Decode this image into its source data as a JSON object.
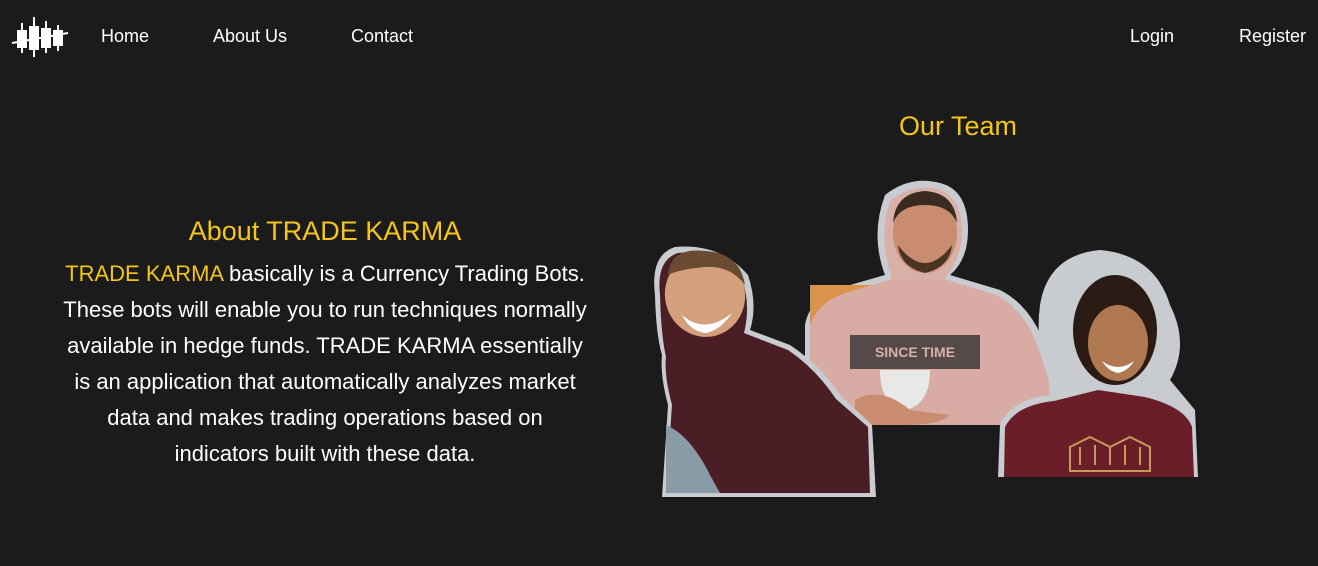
{
  "nav": {
    "links": [
      "Home",
      "About Us",
      "Contact"
    ],
    "login": "Login",
    "register": "Register"
  },
  "about": {
    "title": "About TRADE KARMA",
    "brand": "TRADE KARMA",
    "body": " basically is a Currency Trading Bots. These bots will enable you to run techniques normally available in hedge funds. TRADE KARMA essentially is an application that automatically analyzes market data and makes trading operations based on indicators built with these data."
  },
  "team": {
    "title": "Our Team",
    "shirt_text": "SINCE TIME"
  },
  "colors": {
    "background": "#1b1b1b",
    "accent": "#f5c518",
    "text": "#ffffff"
  },
  "icons": {
    "logo": "candlestick-chart-logo"
  }
}
